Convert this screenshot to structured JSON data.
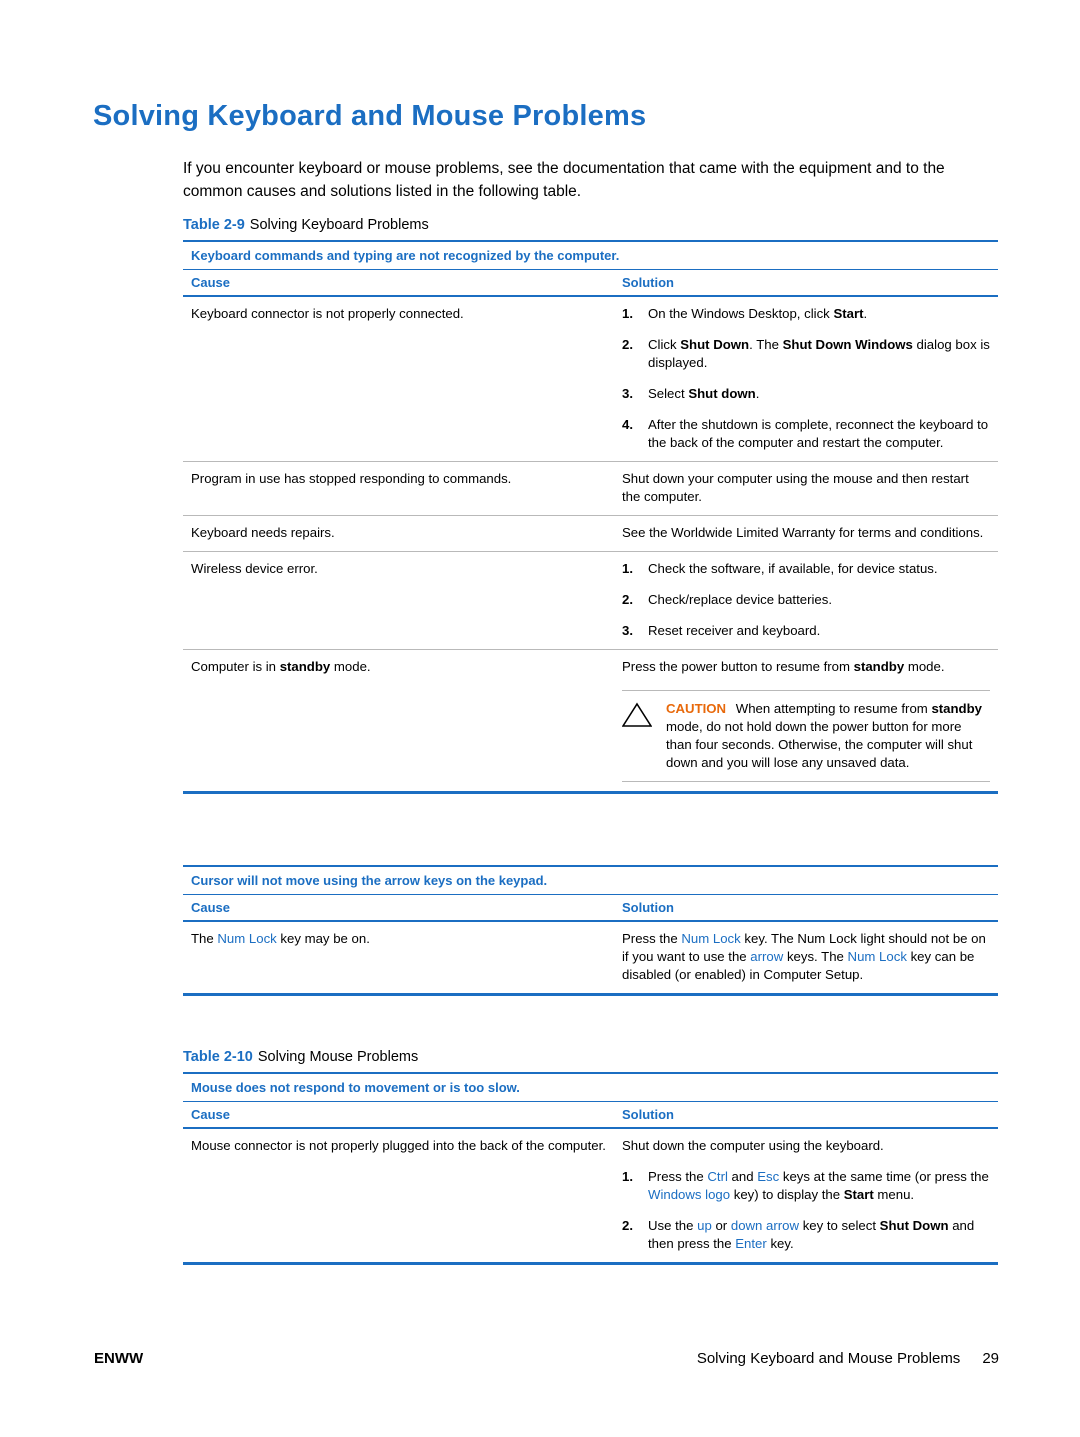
{
  "page": {
    "title": "Solving Keyboard and Mouse Problems",
    "intro": "If you encounter keyboard or mouse problems, see the documentation that came with the equipment and to the common causes and solutions listed in the following table.",
    "footer_left": "ENWW",
    "footer_right": "Solving Keyboard and Mouse Problems",
    "page_number": "29",
    "accent_color": "#1b6ec2",
    "caution_color": "#e8690b"
  },
  "table1": {
    "label": "Table 2-9",
    "caption": "Solving Keyboard Problems",
    "topic": "Keyboard commands and typing are not recognized by the computer.",
    "headers": {
      "cause": "Cause",
      "solution": "Solution"
    },
    "rows": [
      {
        "cause": "Keyboard connector is not properly connected.",
        "solution_steps": [
          {
            "num": "1.",
            "parts": [
              {
                "t": "On the Windows Desktop, click ",
                "s": "plain"
              },
              {
                "t": "Start",
                "s": "bold"
              },
              {
                "t": ".",
                "s": "plain"
              }
            ]
          },
          {
            "num": "2.",
            "parts": [
              {
                "t": "Click ",
                "s": "plain"
              },
              {
                "t": "Shut Down",
                "s": "bold"
              },
              {
                "t": ". The ",
                "s": "plain"
              },
              {
                "t": "Shut Down Windows",
                "s": "bold"
              },
              {
                "t": " dialog box is displayed.",
                "s": "plain"
              }
            ]
          },
          {
            "num": "3.",
            "parts": [
              {
                "t": "Select ",
                "s": "plain"
              },
              {
                "t": "Shut down",
                "s": "bold"
              },
              {
                "t": ".",
                "s": "plain"
              }
            ]
          },
          {
            "num": "4.",
            "parts": [
              {
                "t": "After the shutdown is complete, reconnect the keyboard to the back of the computer and restart the computer.",
                "s": "plain"
              }
            ]
          }
        ]
      },
      {
        "cause": "Program in use has stopped responding to commands.",
        "solution_paragraphs": [
          [
            {
              "t": "Shut down your computer using the mouse and then restart the computer.",
              "s": "plain"
            }
          ]
        ]
      },
      {
        "cause": "Keyboard needs repairs.",
        "solution_paragraphs": [
          [
            {
              "t": "See the Worldwide Limited Warranty for terms and conditions.",
              "s": "plain"
            }
          ]
        ]
      },
      {
        "cause": "Wireless device error.",
        "solution_steps": [
          {
            "num": "1.",
            "parts": [
              {
                "t": "Check the software, if available, for device status.",
                "s": "plain"
              }
            ]
          },
          {
            "num": "2.",
            "parts": [
              {
                "t": "Check/replace device batteries.",
                "s": "plain"
              }
            ]
          },
          {
            "num": "3.",
            "parts": [
              {
                "t": "Reset receiver and keyboard.",
                "s": "plain"
              }
            ]
          }
        ]
      },
      {
        "cause_parts": [
          {
            "t": "Computer is in ",
            "s": "plain"
          },
          {
            "t": "standby",
            "s": "bold"
          },
          {
            "t": " mode.",
            "s": "plain"
          }
        ],
        "solution_paragraphs": [
          [
            {
              "t": "Press the power button to resume from ",
              "s": "plain"
            },
            {
              "t": "standby",
              "s": "bold"
            },
            {
              "t": " mode.",
              "s": "plain"
            }
          ]
        ],
        "caution": {
          "label": "CAUTION",
          "parts": [
            {
              "t": "  When attempting to resume from ",
              "s": "plain"
            },
            {
              "t": "standby",
              "s": "bold"
            },
            {
              "t": " mode, do not hold down the power button for more than four seconds. Otherwise, the computer will shut down and you will lose any unsaved data.",
              "s": "plain"
            }
          ]
        }
      }
    ]
  },
  "table1b": {
    "topic": "Cursor will not move using the arrow keys on the keypad.",
    "headers": {
      "cause": "Cause",
      "solution": "Solution"
    },
    "rows": [
      {
        "cause_parts": [
          {
            "t": "The ",
            "s": "plain"
          },
          {
            "t": "Num Lock",
            "s": "key"
          },
          {
            "t": " key may be on.",
            "s": "plain"
          }
        ],
        "solution_paragraphs": [
          [
            {
              "t": "Press the ",
              "s": "plain"
            },
            {
              "t": "Num Lock",
              "s": "key"
            },
            {
              "t": " key. The Num Lock light should not be on if you want to use the ",
              "s": "plain"
            },
            {
              "t": "arrow",
              "s": "key"
            },
            {
              "t": " keys. The ",
              "s": "plain"
            },
            {
              "t": "Num Lock",
              "s": "key"
            },
            {
              "t": " key can be disabled (or enabled) in Computer Setup.",
              "s": "plain"
            }
          ]
        ]
      }
    ]
  },
  "table2": {
    "label": "Table 2-10",
    "caption": "Solving Mouse Problems",
    "topic": "Mouse does not respond to movement or is too slow.",
    "headers": {
      "cause": "Cause",
      "solution": "Solution"
    },
    "rows": [
      {
        "cause": "Mouse connector is not properly plugged into the back of the computer.",
        "solution_lead": "Shut down the computer using the keyboard.",
        "solution_steps": [
          {
            "num": "1.",
            "parts": [
              {
                "t": "Press the ",
                "s": "plain"
              },
              {
                "t": "Ctrl",
                "s": "key"
              },
              {
                "t": " and ",
                "s": "plain"
              },
              {
                "t": "Esc",
                "s": "key"
              },
              {
                "t": " keys at the same time (or press the ",
                "s": "plain"
              },
              {
                "t": "Windows logo",
                "s": "key"
              },
              {
                "t": " key) to display the ",
                "s": "plain"
              },
              {
                "t": "Start",
                "s": "bold"
              },
              {
                "t": " menu.",
                "s": "plain"
              }
            ]
          },
          {
            "num": "2.",
            "parts": [
              {
                "t": "Use the ",
                "s": "plain"
              },
              {
                "t": "up",
                "s": "key"
              },
              {
                "t": " or ",
                "s": "plain"
              },
              {
                "t": "down arrow",
                "s": "key"
              },
              {
                "t": " key to select ",
                "s": "plain"
              },
              {
                "t": "Shut Down",
                "s": "bold"
              },
              {
                "t": " and then press the ",
                "s": "plain"
              },
              {
                "t": "Enter",
                "s": "key"
              },
              {
                "t": " key.",
                "s": "plain"
              }
            ]
          }
        ]
      }
    ]
  }
}
